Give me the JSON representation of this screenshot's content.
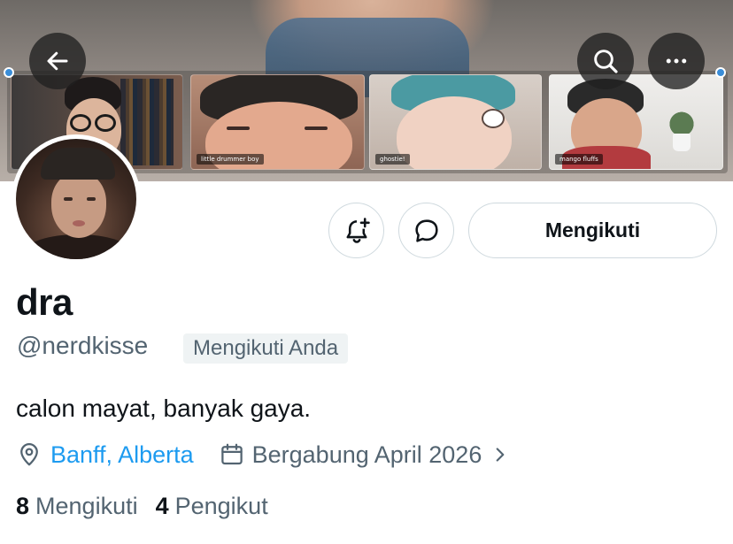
{
  "banner": {
    "tiles": [
      {
        "caption": ""
      },
      {
        "caption": "little drummer boy"
      },
      {
        "caption": "ghostie!"
      },
      {
        "caption": "mango fluffs"
      }
    ]
  },
  "buttons": {
    "follow_label": "Mengikuti"
  },
  "profile": {
    "display_name": "dra",
    "handle": "@nerdkisse",
    "follows_you_badge": "Mengikuti Anda",
    "bio": "calon mayat, banyak gaya.",
    "location": "Banff, Alberta",
    "joined": "Bergabung April 2026"
  },
  "stats": {
    "following_count": "8",
    "following_label": "Mengikuti",
    "followers_count": "4",
    "followers_label": "Pengikut"
  },
  "icons": {
    "back": "arrow-left-icon",
    "search": "search-icon",
    "more": "more-horizontal-icon",
    "notify": "bell-plus-icon",
    "message": "chat-bubble-icon",
    "location": "map-pin-icon",
    "joined": "calendar-icon",
    "chevron": "chevron-right-icon"
  },
  "colors": {
    "link": "#1d9bf0",
    "secondary_text": "#536471",
    "primary_text": "#0f1419",
    "border": "#cfd9de",
    "badge_bg": "#eff3f4"
  }
}
